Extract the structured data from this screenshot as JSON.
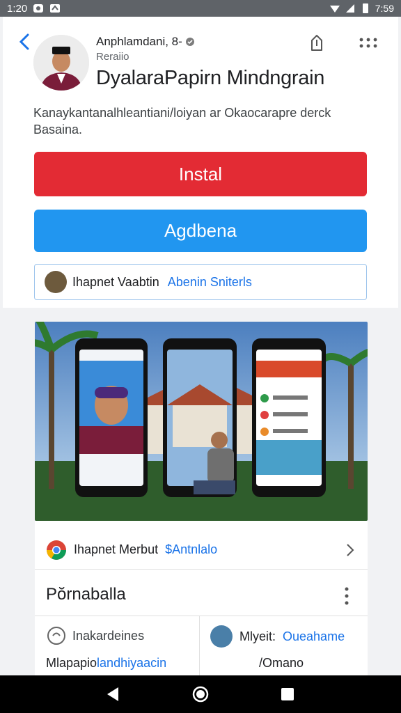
{
  "status_bar": {
    "time": "1:20",
    "battery": "7:59"
  },
  "app": {
    "developer": "Anphlamdani, 8-",
    "sub": "Reraiio",
    "title": "DyalaraPapirn Mindngrain",
    "description": "Kanaykantanalhleantiani/loiyan ar Okaocarapre derck Basaina."
  },
  "buttons": {
    "install": "Instal",
    "secondary": "Agdbena"
  },
  "info_row": {
    "label": "Ihapnet Vaabtin",
    "link": "Abenin Sniterls"
  },
  "details": {
    "link_label": "Ihapnet Merbut",
    "link_accent": "$Antnlalo",
    "section_title": "Pŏrnaballa",
    "cell_a": "Inakardeines",
    "cell_b_dark": "Mlyeit:",
    "cell_b_accent": "Oueahame",
    "cell_c_dark": "Mlapapio",
    "cell_c_accent": "landhiyaacin",
    "cell_d": "/Omano"
  },
  "colors": {
    "install": "#e32b34",
    "secondary": "#2196f0",
    "link": "#1a73e8"
  }
}
